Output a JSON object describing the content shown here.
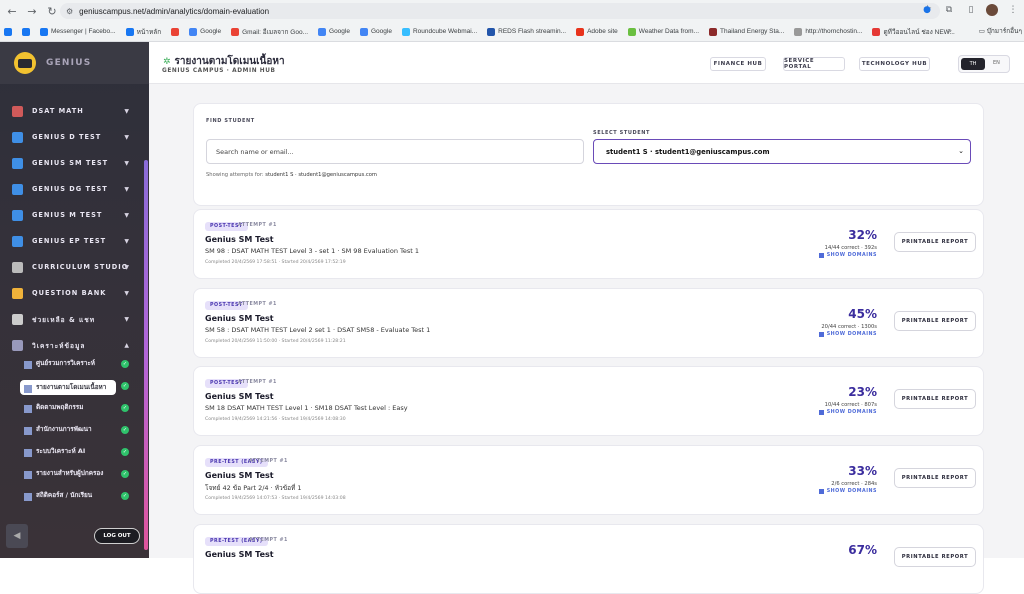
{
  "browser": {
    "url": "geniuscampus.net/admin/analytics/domain-evaluation",
    "bookmarks": [
      {
        "label": "",
        "color": "#1877f2"
      },
      {
        "label": "",
        "color": "#1877f2"
      },
      {
        "label": "Messenger | Facebo...",
        "color": "#1877f2"
      },
      {
        "label": "หน้าหลัก",
        "color": "#1877f2"
      },
      {
        "label": "",
        "color": "#ea4335"
      },
      {
        "label": "Google",
        "color": "#4285f4"
      },
      {
        "label": "Gmail: อีเมลจาก Goo...",
        "color": "#ea4335"
      },
      {
        "label": "Google",
        "color": "#4285f4"
      },
      {
        "label": "Google",
        "color": "#4285f4"
      },
      {
        "label": "Roundcube Webmai...",
        "color": "#37beff"
      },
      {
        "label": "REDS Flash streamin...",
        "color": "#2255aa"
      },
      {
        "label": "Adobe site",
        "color": "#e8331c"
      },
      {
        "label": "Weather Data from...",
        "color": "#6abf40"
      },
      {
        "label": "Thailand Energy Sta...",
        "color": "#8c2a2a"
      },
      {
        "label": "http://thornchostin...",
        "color": "#999999"
      },
      {
        "label": "ดูทีวีออนไลน์ ช่อง NEW...",
        "color": "#e53935"
      }
    ],
    "more": "»",
    "other_bookmarks": "บุ๊กมาร์กอื่นๆ"
  },
  "brand": {
    "name": "GENIUS"
  },
  "nav": [
    {
      "label": "DSAT MATH",
      "color": "#d05a5a"
    },
    {
      "label": "GENIUS D TEST",
      "color": "#3f8fe6"
    },
    {
      "label": "GENIUS SM TEST",
      "color": "#3f8fe6"
    },
    {
      "label": "GENIUS DG TEST",
      "color": "#3f8fe6"
    },
    {
      "label": "GENIUS M TEST",
      "color": "#3f8fe6"
    },
    {
      "label": "GENIUS EP TEST",
      "color": "#3f8fe6"
    },
    {
      "label": "CURRICULUM STUDIO",
      "color": "#bbbbbb"
    },
    {
      "label": "QUESTION BANK",
      "color": "#f0b23a"
    },
    {
      "label": "ช่วยเหลือ & แชท",
      "color": "#cccccc"
    },
    {
      "label": "วิเคราะห์ข้อมูล",
      "color": "#9999bb"
    }
  ],
  "subnav": [
    {
      "label": "ศูนย์รวมการวิเคราะห์",
      "active": false
    },
    {
      "label": "รายงานตามโดเมนเนื้อหา",
      "active": true
    },
    {
      "label": "ติดตามพฤติกรรม",
      "active": false
    },
    {
      "label": "สำนักงานการพัฒนา",
      "active": false
    },
    {
      "label": "ระบบวิเคราะห์ AI",
      "active": false
    },
    {
      "label": "รายงานสำหรับผู้ปกครอง",
      "active": false
    },
    {
      "label": "สถิติคอร์ส / นักเรียน",
      "active": false
    }
  ],
  "logout": "LOG OUT",
  "header": {
    "title": "รายงานตามโดเมนเนื้อหา",
    "subtitle": "GENIUS CAMPUS · ADMIN HUB",
    "buttons": [
      "FINANCE HUB",
      "SERVICE PORTAL",
      "TECHNOLOGY HUB"
    ],
    "lang_on": "TH",
    "lang_off": "EN"
  },
  "find": {
    "label": "FIND STUDENT",
    "placeholder": "Search name or email...",
    "select_label": "SELECT STUDENT",
    "selected": "student1 S · student1@geniuscampus.com",
    "showing_prefix": "Showing attempts for:",
    "showing_value": "student1 S · student1@geniuscampus.com"
  },
  "attempts": [
    {
      "pill": "POST-TEST",
      "attempt": "ATTEMPT #1",
      "title": "Genius SM Test",
      "desc": "SM 98 : DSAT MATH TEST Level 3 - set 1 · SM 98 Evaluation Test 1",
      "meta": "Completed 20/4/2569 17:58:51 · Started 20/4/2569 17:52:19",
      "pct": "32%",
      "correct": "14/44 correct · 392s",
      "domains": "SHOW DOMAINS",
      "report": "PRINTABLE REPORT"
    },
    {
      "pill": "POST-TEST",
      "attempt": "ATTEMPT #1",
      "title": "Genius SM Test",
      "desc": "SM 58 : DSAT MATH TEST Level 2 set 1 · DSAT SM58 - Evaluate Test 1",
      "meta": "Completed 20/4/2569 11:50:00 · Started 20/4/2569 11:28:21",
      "pct": "45%",
      "correct": "20/44 correct · 1300s",
      "domains": "SHOW DOMAINS",
      "report": "PRINTABLE REPORT"
    },
    {
      "pill": "POST-TEST",
      "attempt": "ATTEMPT #1",
      "title": "Genius SM Test",
      "desc": "SM 18 DSAT MATH TEST Level 1 · SM18 DSAT Test Level : Easy",
      "meta": "Completed 19/4/2569 14:21:56 · Started 19/4/2569 14:08:30",
      "pct": "23%",
      "correct": "10/44 correct · 807s",
      "domains": "SHOW DOMAINS",
      "report": "PRINTABLE REPORT"
    },
    {
      "pill": "PRE-TEST (EASY)",
      "attempt": "ATTEMPT #1",
      "title": "Genius SM Test",
      "desc": "โจทย์ 42 ข้อ Part 2/4 · หัวข้อที่ 1",
      "meta": "Completed 19/4/2569 14:07:53 · Started 19/4/2569 14:03:08",
      "pct": "33%",
      "correct": "2/6 correct · 284s",
      "domains": "SHOW DOMAINS",
      "report": "PRINTABLE REPORT"
    },
    {
      "pill": "PRE-TEST (EASY)",
      "attempt": "ATTEMPT #1",
      "title": "Genius SM Test",
      "desc": "",
      "meta": "",
      "pct": "67%",
      "correct": "",
      "domains": "",
      "report": "PRINTABLE REPORT"
    }
  ]
}
